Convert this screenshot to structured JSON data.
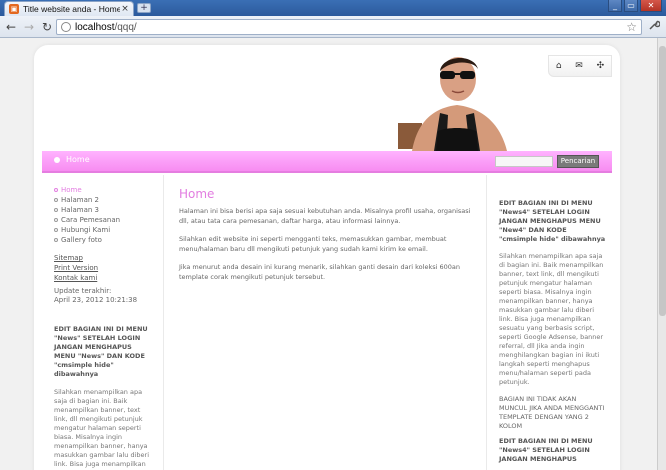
{
  "browser": {
    "tab_title": "Title website anda - Home",
    "tab_close": "×",
    "new_tab": "+",
    "url_host": "localhost",
    "url_path": "/qqq/",
    "back": "←",
    "forward": "→",
    "reload": "↻",
    "star": "☆",
    "wrench": "🔧",
    "minimize": "_",
    "maximize": "▭",
    "close": "✕"
  },
  "header": {
    "icons": [
      "home-icon",
      "mail-icon",
      "sitemap-icon"
    ],
    "icon_glyphs": [
      "⌂",
      "✉",
      "✣"
    ]
  },
  "navbar": {
    "home_label": "Home",
    "search_placeholder": "",
    "search_button": "Pencarian"
  },
  "sidebar": {
    "menu": [
      {
        "label": "Home",
        "active": true
      },
      {
        "label": "Halaman 2",
        "active": false
      },
      {
        "label": "Halaman 3",
        "active": false
      },
      {
        "label": "Cara Pemesanan",
        "active": false
      },
      {
        "label": "Hubungi Kami",
        "active": false
      },
      {
        "label": "Gallery foto",
        "active": false
      }
    ],
    "links": [
      "Sitemap",
      "Print Version",
      "Kontak kami"
    ],
    "updated_label": "Update terakhir:",
    "updated_value": "April 23, 2012 10:21:38",
    "heading": "EDIT BAGIAN INI DI MENU \"News\" SETELAH LOGIN JANGAN MENGHAPUS MENU \"News\" DAN KODE \"cmsimple hide\" dibawahnya",
    "text": "Silahkan menampilkan apa saja di bagian ini. Baik menampilkan banner, text link, dll mengikuti petunjuk mengatur halaman seperti biasa. Misalnya ingin menampilkan banner, hanya masukkan gambar lalu diberi link. Bisa juga menampilkan sesuatu yang berbasis script, seperti Google Adsense"
  },
  "main": {
    "title": "Home",
    "para1": "Halaman ini bisa berisi apa saja sesuai kebutuhan anda. Misalnya profil usaha, organisasi dll, atau tata cara pemesanan, daftar harga, atau informasi lainnya.",
    "para2": "Silahkan edit website ini seperti mengganti teks, memasukkan gambar, membuat menu/halaman baru dll mengikuti petunjuk yang sudah kami kirim ke email.",
    "para3": "Jika menurut anda desain ini kurang menarik, silahkan ganti desain dari koleksi 600an template corak mengikuti petunjuk tersebut."
  },
  "right": {
    "heading": "EDIT BAGIAN INI DI MENU \"News4\" SETELAH LOGIN JANGAN MENGHAPUS MENU \"New4\" DAN KODE \"cmsimple hide\" dibawahnya",
    "text": "Silahkan menampilkan apa saja di bagian ini. Baik menampilkan banner, text link, dll mengikuti petunjuk mengatur halaman seperti biasa. Misalnya ingin menampilkan banner, hanya masukkan gambar lalu diberi link. Bisa juga menampilkan sesuatu yang berbasis script, seperti Google Adsense, banner referral, dll Jika anda ingin menghilangkan bagian ini ikuti langkah seperti menghapus menu/halaman seperti pada petunjuk.",
    "notice": "BAGIAN INI TIDAK AKAN MUNCUL JIKA ANDA MENGGANTI TEMPLATE DENGAN YANG 2 KOLOM",
    "heading2": "EDIT BAGIAN INI DI MENU \"News4\" SETELAH LOGIN JANGAN MENGHAPUS"
  },
  "colors": {
    "accent": "#e27de0",
    "navbar": "#f78cf1"
  }
}
